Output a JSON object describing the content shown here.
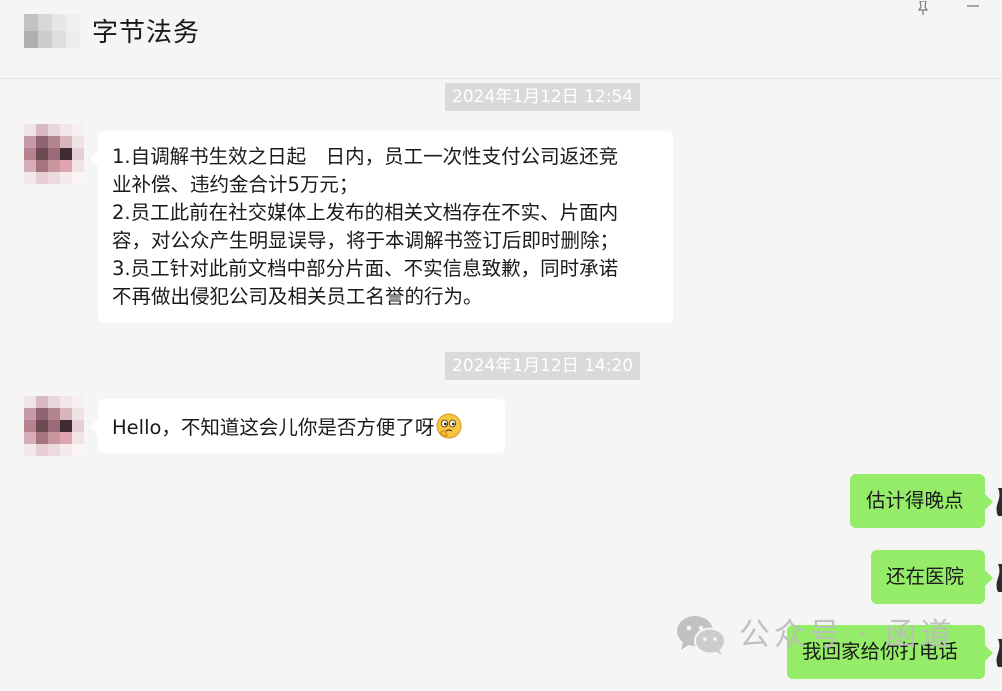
{
  "header": {
    "title": "字节法务"
  },
  "messages": [
    {
      "timestamp": "2024年1月12日 12:54",
      "lines": [
        "1.自调解书生效之日起　日内，员工一次性支付公司返还竞",
        "业补偿、违约金合计5万元；",
        "2.员工此前在社交媒体上发布的相关文档存在不实、片面内",
        "容，对公众产生明显误导，将于本调解书签订后即时删除；",
        "3.员工针对此前文档中部分片面、不实信息致歉，同时承诺",
        "不再做出侵犯公司及相关员工名誉的行为。"
      ]
    },
    {
      "timestamp": "2024年1月12日 14:20",
      "text": "Hello，不知道这会儿你是否方便了呀",
      "emoji": "thinking-face-emoji"
    }
  ],
  "replies": [
    {
      "text": "估计得晚点"
    },
    {
      "text": "还在医院"
    },
    {
      "text": "我回家给你打电话"
    }
  ],
  "watermark": {
    "text": "公众号 · 函道",
    "icon": "wechat-logo-icon"
  },
  "colors": {
    "background": "#f5f5f5",
    "incoming_bubble": "#ffffff",
    "outgoing_bubble": "#95ec69",
    "timestamp_bg": "#dadada"
  }
}
